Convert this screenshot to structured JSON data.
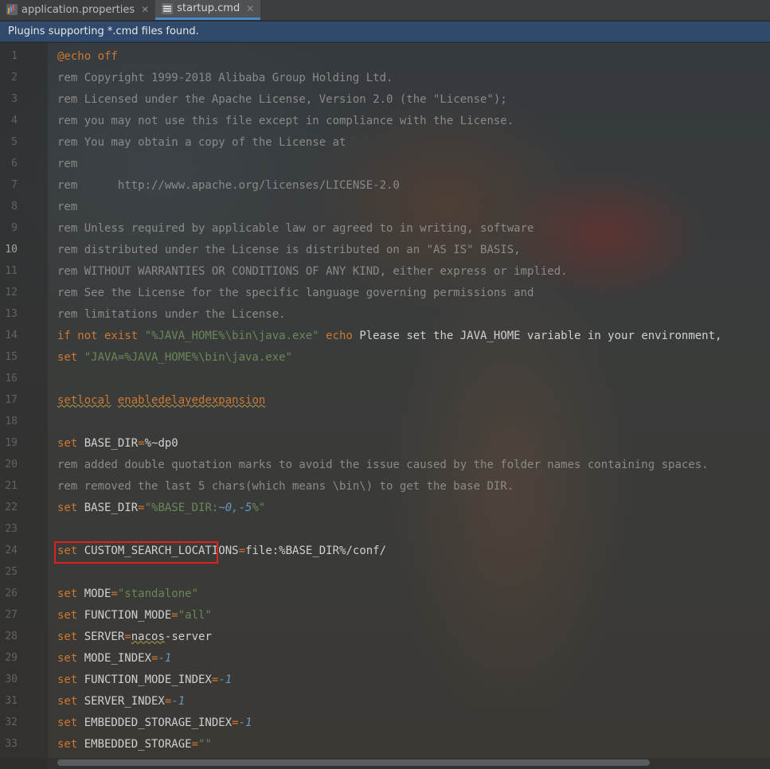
{
  "tabs": [
    {
      "label": "application.properties",
      "icon": "properties-file-icon",
      "active": false
    },
    {
      "label": "startup.cmd",
      "icon": "cmd-file-icon",
      "active": true
    }
  ],
  "notification": {
    "text": "Plugins supporting *.cmd files found."
  },
  "editor": {
    "current_line": 10,
    "lines": [
      {
        "n": "1"
      },
      {
        "n": "2"
      },
      {
        "n": "3"
      },
      {
        "n": "4"
      },
      {
        "n": "5"
      },
      {
        "n": "6"
      },
      {
        "n": "7"
      },
      {
        "n": "8"
      },
      {
        "n": "9"
      },
      {
        "n": "10"
      },
      {
        "n": "11"
      },
      {
        "n": "12"
      },
      {
        "n": "13"
      },
      {
        "n": "14"
      },
      {
        "n": "15"
      },
      {
        "n": "16"
      },
      {
        "n": "17"
      },
      {
        "n": "18"
      },
      {
        "n": "19"
      },
      {
        "n": "20"
      },
      {
        "n": "21"
      },
      {
        "n": "22"
      },
      {
        "n": "23"
      },
      {
        "n": "24"
      },
      {
        "n": "25"
      },
      {
        "n": "26"
      },
      {
        "n": "27"
      },
      {
        "n": "28"
      },
      {
        "n": "29"
      },
      {
        "n": "30"
      },
      {
        "n": "31"
      },
      {
        "n": "32"
      },
      {
        "n": "33"
      }
    ],
    "code": {
      "l1": {
        "a": "@echo off"
      },
      "l2": {
        "a": "rem Copyright 1999-2018 Alibaba Group Holding Ltd."
      },
      "l3": {
        "a": "rem Licensed under the Apache License, Version 2.0 (the \"License\");"
      },
      "l4": {
        "a": "rem you may not use this file except in compliance with the License."
      },
      "l5": {
        "a": "rem You may obtain a copy of the License at"
      },
      "l6": {
        "a": "rem"
      },
      "l7": {
        "a": "rem      http://www.apache.org/licenses/LICENSE-2.0"
      },
      "l8": {
        "a": "rem"
      },
      "l9": {
        "a": "rem Unless required by applicable law or agreed to in writing, software"
      },
      "l10": {
        "a": "rem distributed under the License is distributed on an \"AS IS\" BASIS,"
      },
      "l11": {
        "a": "rem WITHOUT WARRANTIES OR CONDITIONS OF ANY KIND, either express or implied."
      },
      "l12": {
        "a": "rem See the License for the specific language governing permissions and"
      },
      "l13": {
        "a": "rem limitations under the License."
      },
      "l14": {
        "kw1": "if not exist ",
        "s1": "\"%JAVA_HOME%\\bin\\java.exe\"",
        "kw2": " echo",
        "rest": " Please set the JAVA_HOME variable in your environment,"
      },
      "l15": {
        "kw": "set ",
        "s": "\"JAVA=%JAVA_HOME%\\bin\\java.exe\""
      },
      "l17": {
        "k1": "setlocal",
        "k2": "enabledelayedexpansion"
      },
      "l19": {
        "kw": "set ",
        "name": "BASE_DIR",
        "eq": "=",
        "val": "%~dp0"
      },
      "l20": {
        "a": "rem added double quotation marks to avoid the issue caused by the folder names containing spaces."
      },
      "l21": {
        "a": "rem removed the last 5 chars(which means \\bin\\) to get the base DIR."
      },
      "l22": {
        "kw": "set ",
        "name": "BASE_DIR",
        "eq": "=",
        "s1": "\"%BASE_DIR:",
        "n1": "~0,-5",
        "s2": "%\""
      },
      "l24": {
        "kw": "set ",
        "name": "CUSTOM_SEARCH_LOCATIONS",
        "eq": "=",
        "val": "file:%BASE_DIR%/conf/"
      },
      "l26": {
        "kw": "set ",
        "name": "MODE",
        "eq": "=",
        "s": "\"standalone\""
      },
      "l27": {
        "kw": "set ",
        "name": "FUNCTION_MODE",
        "eq": "=",
        "s": "\"all\""
      },
      "l28": {
        "kw": "set ",
        "name": "SERVER",
        "eq": "=",
        "v1": "nacos",
        "v2": "-server"
      },
      "l29": {
        "kw": "set ",
        "name": "MODE_INDEX",
        "eq": "=",
        "n": "-1"
      },
      "l30": {
        "kw": "set ",
        "name": "FUNCTION_MODE_INDEX",
        "eq": "=",
        "n": "-1"
      },
      "l31": {
        "kw": "set ",
        "name": "SERVER_INDEX",
        "eq": "=",
        "n": "-1"
      },
      "l32": {
        "kw": "set ",
        "name": "EMBEDDED_STORAGE_INDEX",
        "eq": "=",
        "n": "-1"
      },
      "l33": {
        "kw": "set ",
        "name": "EMBEDDED_STORAGE",
        "eq": "=",
        "s": "\"\""
      }
    }
  },
  "colors": {
    "keyword": "#cc7832",
    "comment": "#8a8a8a",
    "string": "#6a8759",
    "number": "#6897bb",
    "highlight_box": "#e02020"
  }
}
